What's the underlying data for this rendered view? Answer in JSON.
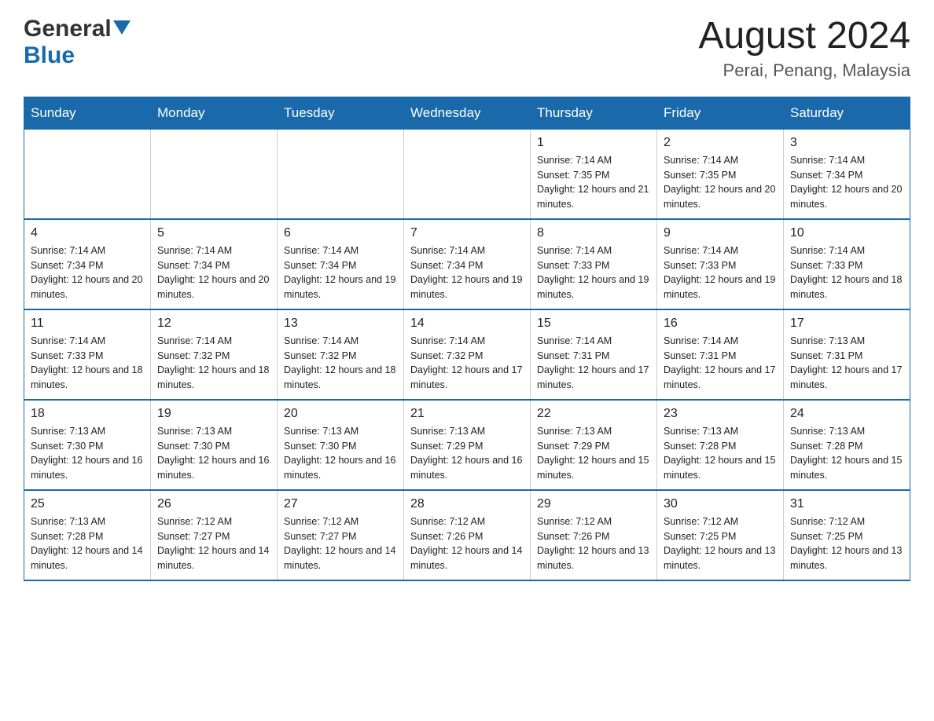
{
  "header": {
    "logo_general": "General",
    "logo_blue": "Blue",
    "month_year": "August 2024",
    "location": "Perai, Penang, Malaysia"
  },
  "days_of_week": [
    "Sunday",
    "Monday",
    "Tuesday",
    "Wednesday",
    "Thursday",
    "Friday",
    "Saturday"
  ],
  "weeks": [
    [
      {
        "day": "",
        "sunrise": "",
        "sunset": "",
        "daylight": ""
      },
      {
        "day": "",
        "sunrise": "",
        "sunset": "",
        "daylight": ""
      },
      {
        "day": "",
        "sunrise": "",
        "sunset": "",
        "daylight": ""
      },
      {
        "day": "",
        "sunrise": "",
        "sunset": "",
        "daylight": ""
      },
      {
        "day": "1",
        "sunrise": "Sunrise: 7:14 AM",
        "sunset": "Sunset: 7:35 PM",
        "daylight": "Daylight: 12 hours and 21 minutes."
      },
      {
        "day": "2",
        "sunrise": "Sunrise: 7:14 AM",
        "sunset": "Sunset: 7:35 PM",
        "daylight": "Daylight: 12 hours and 20 minutes."
      },
      {
        "day": "3",
        "sunrise": "Sunrise: 7:14 AM",
        "sunset": "Sunset: 7:34 PM",
        "daylight": "Daylight: 12 hours and 20 minutes."
      }
    ],
    [
      {
        "day": "4",
        "sunrise": "Sunrise: 7:14 AM",
        "sunset": "Sunset: 7:34 PM",
        "daylight": "Daylight: 12 hours and 20 minutes."
      },
      {
        "day": "5",
        "sunrise": "Sunrise: 7:14 AM",
        "sunset": "Sunset: 7:34 PM",
        "daylight": "Daylight: 12 hours and 20 minutes."
      },
      {
        "day": "6",
        "sunrise": "Sunrise: 7:14 AM",
        "sunset": "Sunset: 7:34 PM",
        "daylight": "Daylight: 12 hours and 19 minutes."
      },
      {
        "day": "7",
        "sunrise": "Sunrise: 7:14 AM",
        "sunset": "Sunset: 7:34 PM",
        "daylight": "Daylight: 12 hours and 19 minutes."
      },
      {
        "day": "8",
        "sunrise": "Sunrise: 7:14 AM",
        "sunset": "Sunset: 7:33 PM",
        "daylight": "Daylight: 12 hours and 19 minutes."
      },
      {
        "day": "9",
        "sunrise": "Sunrise: 7:14 AM",
        "sunset": "Sunset: 7:33 PM",
        "daylight": "Daylight: 12 hours and 19 minutes."
      },
      {
        "day": "10",
        "sunrise": "Sunrise: 7:14 AM",
        "sunset": "Sunset: 7:33 PM",
        "daylight": "Daylight: 12 hours and 18 minutes."
      }
    ],
    [
      {
        "day": "11",
        "sunrise": "Sunrise: 7:14 AM",
        "sunset": "Sunset: 7:33 PM",
        "daylight": "Daylight: 12 hours and 18 minutes."
      },
      {
        "day": "12",
        "sunrise": "Sunrise: 7:14 AM",
        "sunset": "Sunset: 7:32 PM",
        "daylight": "Daylight: 12 hours and 18 minutes."
      },
      {
        "day": "13",
        "sunrise": "Sunrise: 7:14 AM",
        "sunset": "Sunset: 7:32 PM",
        "daylight": "Daylight: 12 hours and 18 minutes."
      },
      {
        "day": "14",
        "sunrise": "Sunrise: 7:14 AM",
        "sunset": "Sunset: 7:32 PM",
        "daylight": "Daylight: 12 hours and 17 minutes."
      },
      {
        "day": "15",
        "sunrise": "Sunrise: 7:14 AM",
        "sunset": "Sunset: 7:31 PM",
        "daylight": "Daylight: 12 hours and 17 minutes."
      },
      {
        "day": "16",
        "sunrise": "Sunrise: 7:14 AM",
        "sunset": "Sunset: 7:31 PM",
        "daylight": "Daylight: 12 hours and 17 minutes."
      },
      {
        "day": "17",
        "sunrise": "Sunrise: 7:13 AM",
        "sunset": "Sunset: 7:31 PM",
        "daylight": "Daylight: 12 hours and 17 minutes."
      }
    ],
    [
      {
        "day": "18",
        "sunrise": "Sunrise: 7:13 AM",
        "sunset": "Sunset: 7:30 PM",
        "daylight": "Daylight: 12 hours and 16 minutes."
      },
      {
        "day": "19",
        "sunrise": "Sunrise: 7:13 AM",
        "sunset": "Sunset: 7:30 PM",
        "daylight": "Daylight: 12 hours and 16 minutes."
      },
      {
        "day": "20",
        "sunrise": "Sunrise: 7:13 AM",
        "sunset": "Sunset: 7:30 PM",
        "daylight": "Daylight: 12 hours and 16 minutes."
      },
      {
        "day": "21",
        "sunrise": "Sunrise: 7:13 AM",
        "sunset": "Sunset: 7:29 PM",
        "daylight": "Daylight: 12 hours and 16 minutes."
      },
      {
        "day": "22",
        "sunrise": "Sunrise: 7:13 AM",
        "sunset": "Sunset: 7:29 PM",
        "daylight": "Daylight: 12 hours and 15 minutes."
      },
      {
        "day": "23",
        "sunrise": "Sunrise: 7:13 AM",
        "sunset": "Sunset: 7:28 PM",
        "daylight": "Daylight: 12 hours and 15 minutes."
      },
      {
        "day": "24",
        "sunrise": "Sunrise: 7:13 AM",
        "sunset": "Sunset: 7:28 PM",
        "daylight": "Daylight: 12 hours and 15 minutes."
      }
    ],
    [
      {
        "day": "25",
        "sunrise": "Sunrise: 7:13 AM",
        "sunset": "Sunset: 7:28 PM",
        "daylight": "Daylight: 12 hours and 14 minutes."
      },
      {
        "day": "26",
        "sunrise": "Sunrise: 7:12 AM",
        "sunset": "Sunset: 7:27 PM",
        "daylight": "Daylight: 12 hours and 14 minutes."
      },
      {
        "day": "27",
        "sunrise": "Sunrise: 7:12 AM",
        "sunset": "Sunset: 7:27 PM",
        "daylight": "Daylight: 12 hours and 14 minutes."
      },
      {
        "day": "28",
        "sunrise": "Sunrise: 7:12 AM",
        "sunset": "Sunset: 7:26 PM",
        "daylight": "Daylight: 12 hours and 14 minutes."
      },
      {
        "day": "29",
        "sunrise": "Sunrise: 7:12 AM",
        "sunset": "Sunset: 7:26 PM",
        "daylight": "Daylight: 12 hours and 13 minutes."
      },
      {
        "day": "30",
        "sunrise": "Sunrise: 7:12 AM",
        "sunset": "Sunset: 7:25 PM",
        "daylight": "Daylight: 12 hours and 13 minutes."
      },
      {
        "day": "31",
        "sunrise": "Sunrise: 7:12 AM",
        "sunset": "Sunset: 7:25 PM",
        "daylight": "Daylight: 12 hours and 13 minutes."
      }
    ]
  ]
}
